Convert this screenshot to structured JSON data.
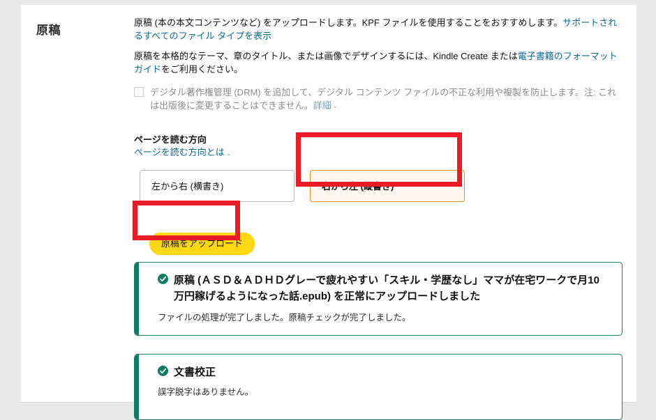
{
  "page": {
    "background": "#e9e9e9",
    "card_background": "#ffffff"
  },
  "section": {
    "title": "原稿",
    "intro": {
      "text_before_link": "原稿 (本の本文コンテンツなど) をアップロードします。KPF ファイルを使用することをおすすめします。",
      "link": "サポートされるすべてのファイル タイプを表示"
    },
    "design_note": {
      "text_before_link": "原稿を本格的なテーマ、章のタイトル、または画像でデザインするには、Kindle Create または",
      "link": "電子書籍のフォーマット ガイド",
      "text_after_link": "をご利用ください。"
    },
    "drm": {
      "checked": false,
      "text_before_link": "デジタル著作権管理 (DRM) を追加して、デジタル コンテンツ ファイルの不正な利用や複製を防止します。注: これは出版後に変更することはできません。",
      "link": "詳細",
      "caret": "⌄"
    }
  },
  "reading_direction": {
    "label": "ページを読む方向",
    "help_link": "ページを読む方向とは",
    "help_caret": "⌄",
    "options": [
      {
        "label": "左から右 (横書き)",
        "selected": false
      },
      {
        "label": "右から左 (縦書き)",
        "selected": true
      }
    ],
    "selected_border_color": "#e0901f",
    "selected_background": "#fdf8f2"
  },
  "upload": {
    "button_label": "原稿をアップロード",
    "button_color": "#ffd814"
  },
  "alerts": [
    {
      "id": "manuscript-upload",
      "icon": "check-circle-icon",
      "title": "原稿 (ＡＳＤ＆ＡＤＨＤグレーで疲れやすい「スキル・学歴なし」ママが在宅ワークで月10万円稼げるようになった話.epub) を正常にアップロードしました",
      "body": "ファイルの処理が完了しました。原稿チェックが完了しました。",
      "accent_color": "#0f7b63"
    },
    {
      "id": "document-proofing",
      "icon": "check-circle-icon",
      "title": "文書校正",
      "body": "誤字脱字はありません。",
      "accent_color": "#0f7b63"
    }
  ],
  "annotations": [
    {
      "id": "rtl-option-highlight",
      "color": "#ed1c24"
    },
    {
      "id": "upload-button-highlight",
      "color": "#ed1c24"
    }
  ]
}
